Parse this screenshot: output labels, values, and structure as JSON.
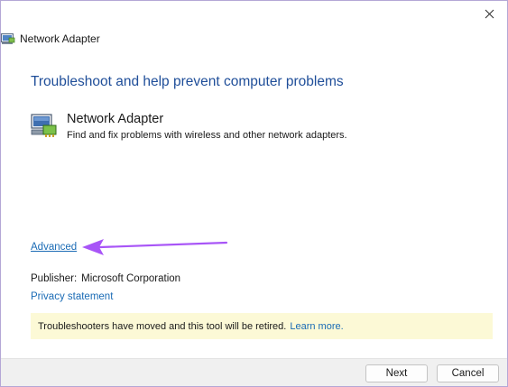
{
  "window": {
    "title": "Network Adapter",
    "close_icon": "close-icon",
    "title_icon": "network-adapter-icon"
  },
  "main": {
    "heading": "Troubleshoot and help prevent computer problems",
    "item": {
      "icon": "network-adapter-icon",
      "title": "Network Adapter",
      "description": "Find and fix problems with wireless and other network adapters."
    },
    "advanced_link": "Advanced",
    "publisher_label": "Publisher:",
    "publisher_value": "Microsoft Corporation",
    "privacy_link": "Privacy statement",
    "notice": {
      "text": "Troubleshooters have moved and this tool will be retired.",
      "link": "Learn more."
    },
    "annotation_arrow_color": "#a855f7"
  },
  "footer": {
    "next_label": "Next",
    "cancel_label": "Cancel"
  },
  "colors": {
    "heading": "#1f4e99",
    "link": "#1a6bb5",
    "notice_bg": "#fcf9d6",
    "footer_bg": "#f0f0f0"
  }
}
